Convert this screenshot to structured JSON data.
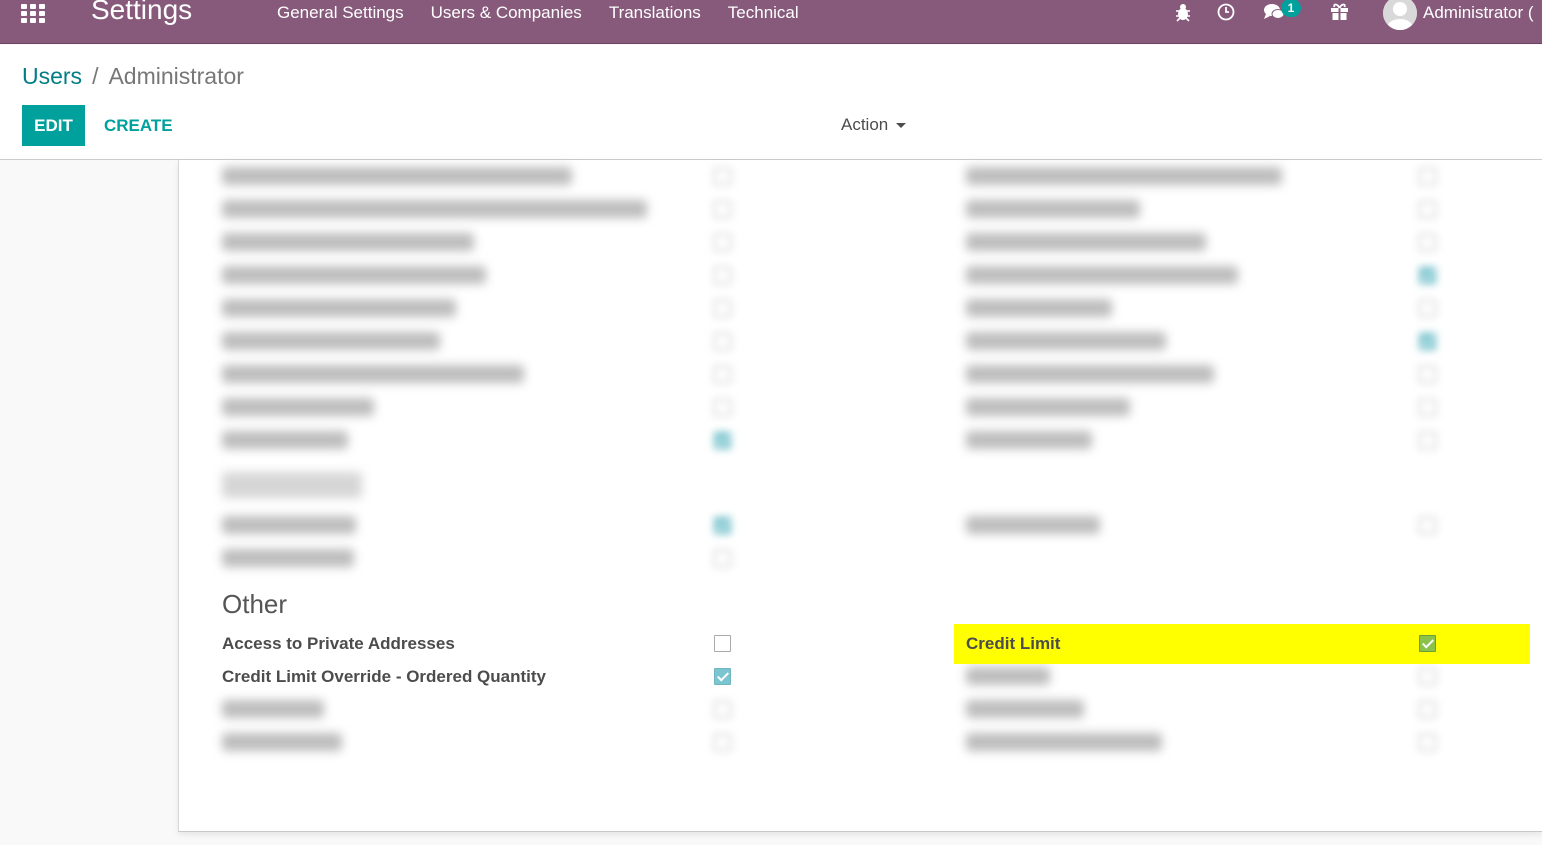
{
  "navbar": {
    "brand": "Settings",
    "menu": [
      "General Settings",
      "Users & Companies",
      "Translations",
      "Technical"
    ],
    "chat_badge": "1",
    "user_name": "Administrator ("
  },
  "breadcrumb": {
    "parent": "Users",
    "separator": "/",
    "current": "Administrator"
  },
  "toolbar": {
    "edit_label": "EDIT",
    "create_label": "CREATE",
    "action_label": "Action"
  },
  "sections": {
    "other_title": "Other"
  },
  "other_fields": {
    "access_private": {
      "label": "Access to Private Addresses",
      "checked": false
    },
    "credit_override": {
      "label": "Credit Limit Override - Ordered Quantity",
      "checked": true
    },
    "credit_limit": {
      "label": "Credit Limit",
      "checked": true
    }
  },
  "colors": {
    "navbar": "#875a7b",
    "accent": "#00a09d",
    "highlight": "#ffff00"
  }
}
